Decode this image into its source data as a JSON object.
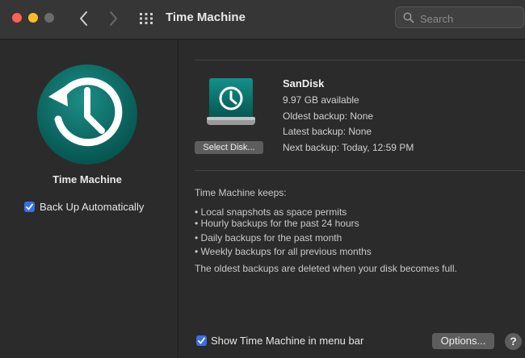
{
  "window": {
    "title": "Time Machine",
    "search_placeholder": "Search"
  },
  "sidebar": {
    "title": "Time Machine",
    "back_up_automatically": {
      "label": "Back Up Automatically",
      "checked": true
    }
  },
  "disk": {
    "name": "SanDisk",
    "available": "9.97 GB available",
    "oldest_backup": "Oldest backup: None",
    "latest_backup": "Latest backup: None",
    "next_backup": "Next backup: Today, 12:59 PM",
    "select_disk_label": "Select Disk..."
  },
  "keeps": {
    "heading": "Time Machine keeps:",
    "items": [
      "• Local snapshots as space permits",
      "• Hourly backups for the past 24 hours",
      "• Daily backups for the past month",
      "• Weekly backups for all previous months"
    ],
    "footer": "The oldest backups are deleted when your disk becomes full."
  },
  "bottom": {
    "show_in_menu_bar": {
      "label": "Show Time Machine in menu bar",
      "checked": true
    },
    "options_label": "Options...",
    "help_label": "?"
  },
  "colors": {
    "accent": "#3a6ee8",
    "icon_teal": "#0a6b66"
  },
  "icons": [
    "close-button",
    "minimize-button",
    "zoom-button",
    "back-icon",
    "forward-icon",
    "grid-icon",
    "search-icon",
    "time-machine-icon",
    "drive-icon",
    "checkmark-icon"
  ]
}
